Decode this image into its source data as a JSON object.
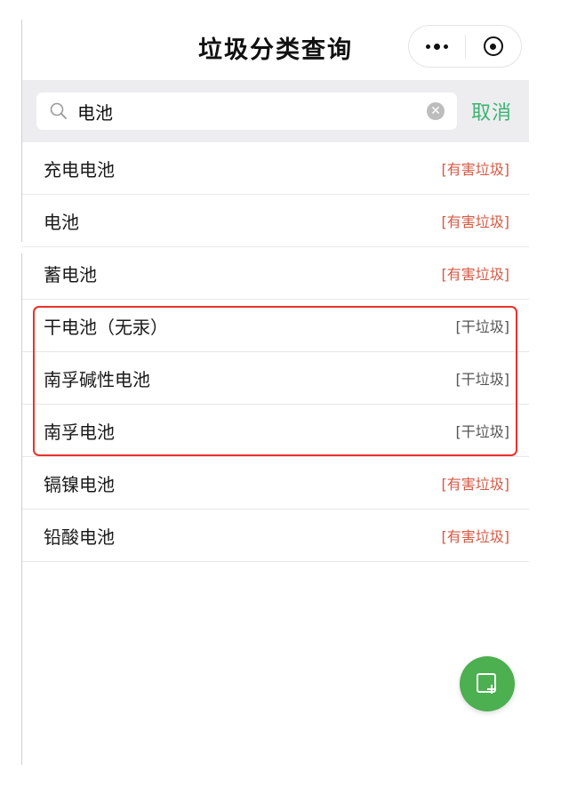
{
  "header": {
    "title": "垃圾分类查询",
    "more_icon": "more-dots-icon",
    "close_icon": "target-close-icon"
  },
  "search": {
    "value": "电池",
    "cancel_label": "取消",
    "icon": "search-icon",
    "clear_icon": "clear-icon"
  },
  "results": [
    {
      "name": "充电电池",
      "category": "[有害垃圾]",
      "type": "hazardous"
    },
    {
      "name": "电池",
      "category": "[有害垃圾]",
      "type": "hazardous"
    },
    {
      "name": "蓄电池",
      "category": "[有害垃圾]",
      "type": "hazardous"
    },
    {
      "name": "干电池（无汞）",
      "category": "[干垃圾]",
      "type": "dry"
    },
    {
      "name": "南孚碱性电池",
      "category": "[干垃圾]",
      "type": "dry"
    },
    {
      "name": "南孚电池",
      "category": "[干垃圾]",
      "type": "dry"
    },
    {
      "name": "镉镍电池",
      "category": "[有害垃圾]",
      "type": "hazardous"
    },
    {
      "name": "铅酸电池",
      "category": "[有害垃圾]",
      "type": "hazardous"
    }
  ],
  "colors": {
    "accent": "#3cb371",
    "hazardous": "#d65a46",
    "dry": "#555555",
    "highlight": "#e8322d",
    "fab": "#4caf50"
  },
  "fab_icon": "add-note-icon"
}
